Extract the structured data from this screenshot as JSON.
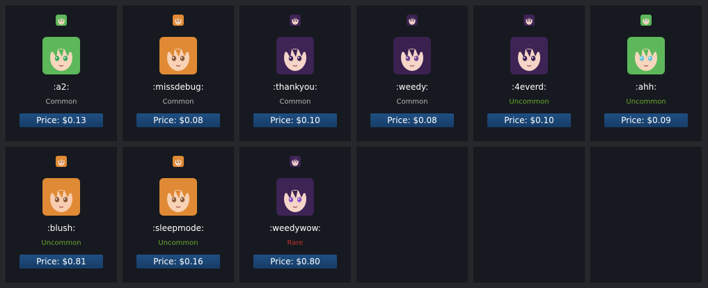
{
  "items": [
    {
      "name": ":a2:",
      "rarity": "Common",
      "rarity_color": "#b5b5b5",
      "price": "Price: $0.13",
      "hair": "#5cb85a",
      "skin": "#f6d6bd",
      "eyes": "#3aa860",
      "icon": "green-haired-girl-emote-icon"
    },
    {
      "name": ":missdebug:",
      "rarity": "Common",
      "rarity_color": "#b5b5b5",
      "price": "Price: $0.08",
      "hair": "#e08a35",
      "skin": "#f8d2b4",
      "eyes": "#8a5a3a",
      "icon": "orange-haired-girl-emote-icon"
    },
    {
      "name": ":thankyou:",
      "rarity": "Common",
      "rarity_color": "#b5b5b5",
      "price": "Price: $0.10",
      "hair": "#3e2355",
      "skin": "#f5d5c8",
      "eyes": "#3e2355",
      "icon": "purple-haired-girl-smiling-emote-icon"
    },
    {
      "name": ":weedy:",
      "rarity": "Common",
      "rarity_color": "#b5b5b5",
      "price": "Price: $0.08",
      "hair": "#3a2150",
      "skin": "#f5d5c8",
      "eyes": "#6a3f8f",
      "icon": "purple-haired-girl-emote-icon"
    },
    {
      "name": ":4everd:",
      "rarity": "Uncommon",
      "rarity_color": "#6aa72e",
      "price": "Price: $0.10",
      "hair": "#3e2355",
      "skin": "#f5d5c8",
      "eyes": "#3e2355",
      "icon": "purple-haired-girl-sleepy-emote-icon"
    },
    {
      "name": ":ahh:",
      "rarity": "Uncommon",
      "rarity_color": "#6aa72e",
      "price": "Price: $0.09",
      "hair": "#5cb85a",
      "skin": "#f6d6bd",
      "eyes": "#6bc3d8",
      "icon": "green-haired-girl-shocked-emote-icon"
    },
    {
      "name": ":blush:",
      "rarity": "Uncommon",
      "rarity_color": "#6aa72e",
      "price": "Price: $0.81",
      "hair": "#e08a35",
      "skin": "#f8cdb0",
      "eyes": "#8a5a3a",
      "icon": "orange-haired-girl-blushing-emote-icon"
    },
    {
      "name": ":sleepmode:",
      "rarity": "Uncommon",
      "rarity_color": "#6aa72e",
      "price": "Price: $0.16",
      "hair": "#e08a35",
      "skin": "#f8d2b4",
      "eyes": "#8a5a3a",
      "icon": "orange-haired-girl-sleeping-emote-icon"
    },
    {
      "name": ":weedywow:",
      "rarity": "Rare",
      "rarity_color": "#c2322b",
      "price": "Price: $0.80",
      "hair": "#3e2355",
      "skin": "#f5d5c8",
      "eyes": "#8a4fc8",
      "icon": "purple-haired-girl-surprised-emote-icon"
    }
  ]
}
